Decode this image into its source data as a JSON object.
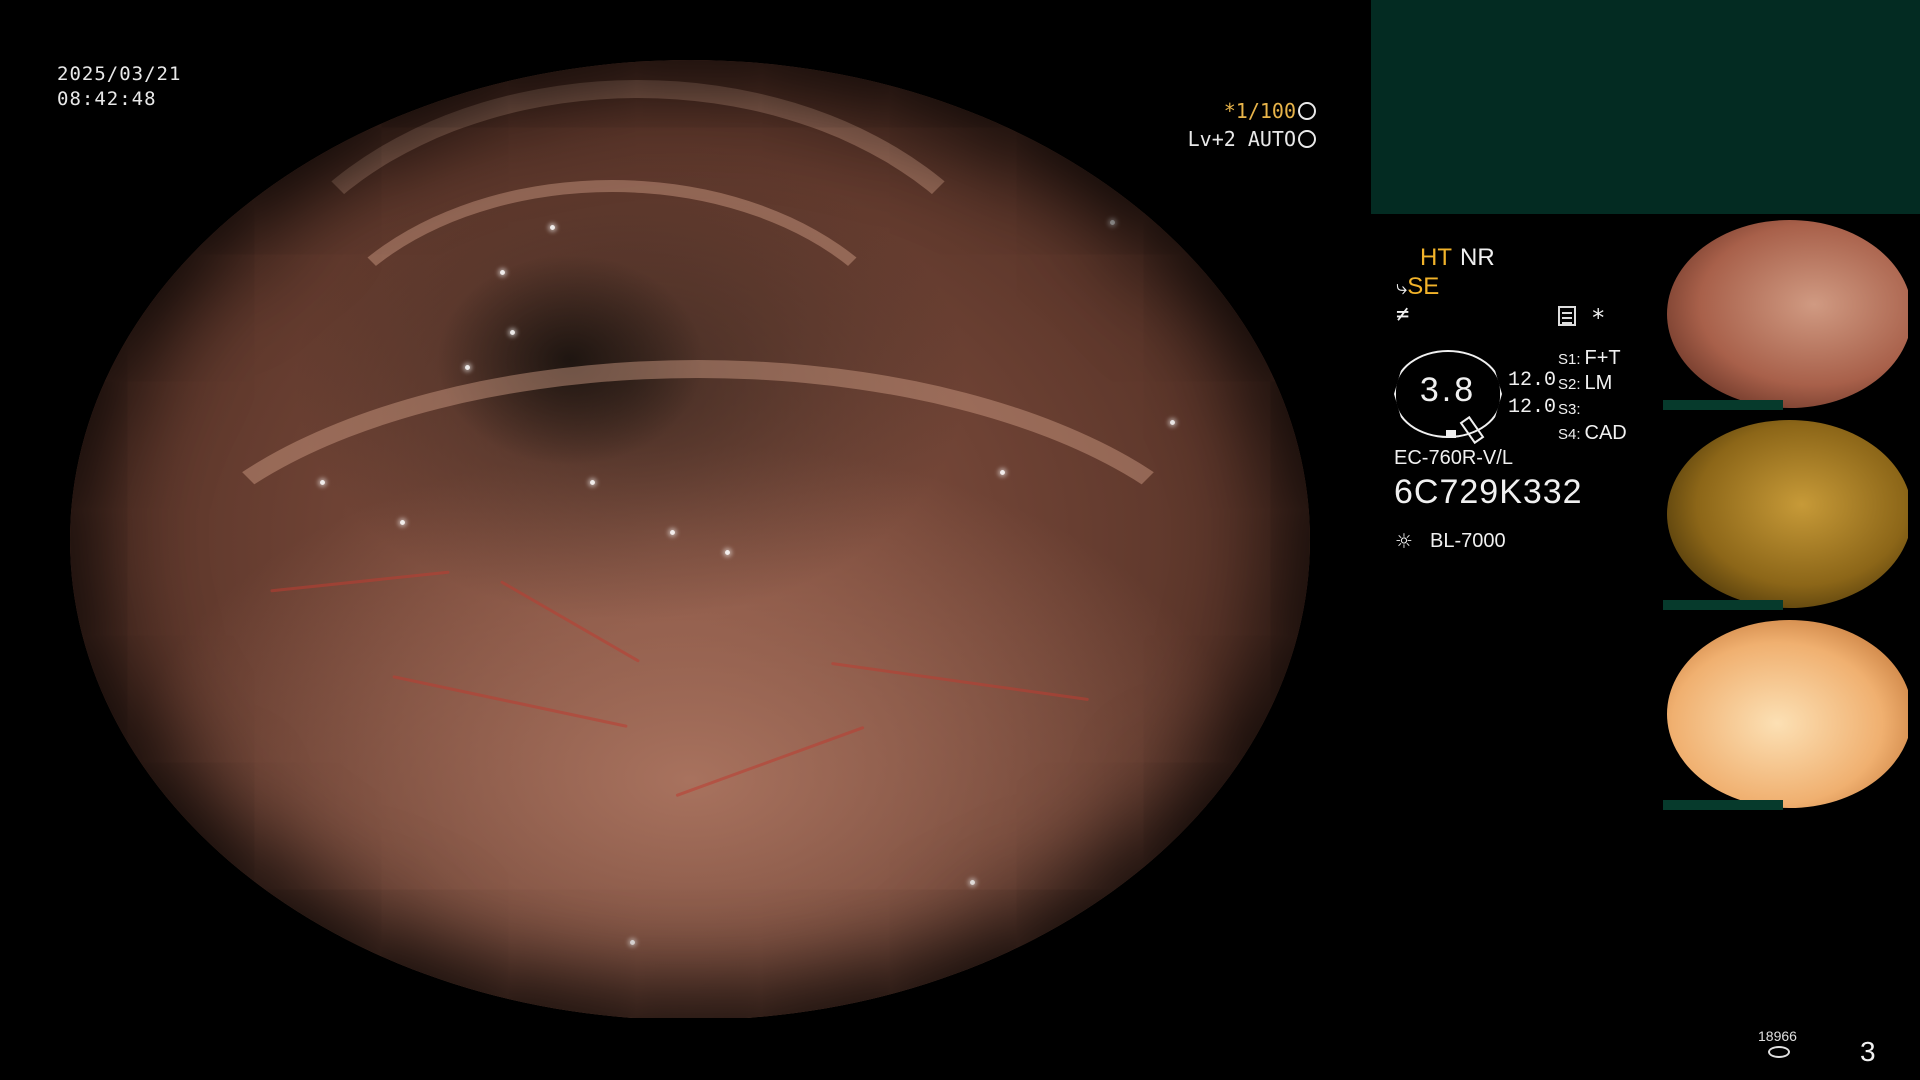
{
  "overlay": {
    "date": "2025/03/21",
    "time": "08:42:48",
    "shutter": "*1/100",
    "level": "Lv+2 AUTO"
  },
  "modes": {
    "ht": "HT",
    "nr": "NR",
    "se": "SE",
    "se_symbol": "⤷",
    "fx_symbol": "≠",
    "star": "*"
  },
  "gauge": {
    "value": "3.8",
    "num1": "12.0",
    "num2": "12.0"
  },
  "switches": [
    {
      "key": "S1:",
      "value": "F+T"
    },
    {
      "key": "S2:",
      "value": "LM"
    },
    {
      "key": "S3:",
      "value": ""
    },
    {
      "key": "S4:",
      "value": "CAD"
    }
  ],
  "scope": {
    "model": "EC-760R-V/L",
    "serial": "6C729K332",
    "light_source": "BL-7000"
  },
  "footer": {
    "counter": "18966",
    "page": "3"
  },
  "colors": {
    "accent": "#f2b32a",
    "panel": "#032b22"
  }
}
